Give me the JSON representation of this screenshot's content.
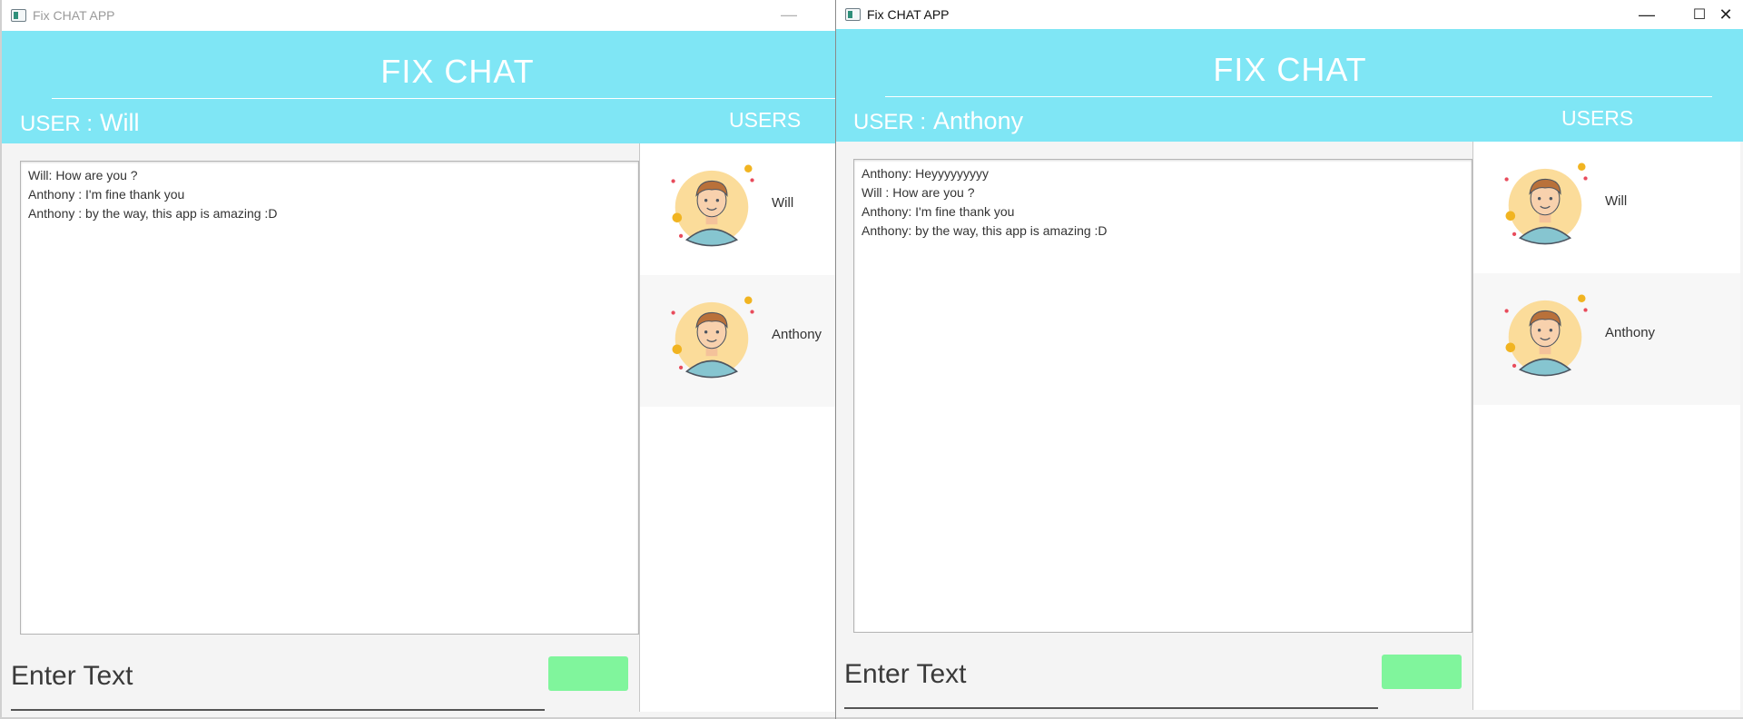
{
  "colors": {
    "header_bg": "#7fe6f5",
    "send_button": "#80f59c",
    "window_bg": "#f4f4f4"
  },
  "windows": [
    {
      "id": "will",
      "title": "Fix CHAT APP",
      "app_title": "FIX CHAT",
      "user_prefix": "USER :",
      "user_name": "Will",
      "users_title": "USERS",
      "messages": [
        "Will: How are you ?",
        "Anthony : I'm fine thank you",
        "Anthony : by the way, this app is amazing :D"
      ],
      "input_placeholder": "Enter Text",
      "users": [
        {
          "name": "Will",
          "avatar_icon": "user-avatar-icon"
        },
        {
          "name": "Anthony",
          "avatar_icon": "user-avatar-icon"
        }
      ]
    },
    {
      "id": "anthony",
      "title": "Fix CHAT APP",
      "app_title": "FIX CHAT",
      "user_prefix": "USER :",
      "user_name": "Anthony",
      "users_title": "USERS",
      "messages": [
        "Anthony: Heyyyyyyyyy",
        "Will : How are you ?",
        "Anthony: I'm fine thank you",
        "Anthony: by the way, this app is amazing :D"
      ],
      "input_placeholder": "Enter Text",
      "users": [
        {
          "name": "Will",
          "avatar_icon": "user-avatar-icon"
        },
        {
          "name": "Anthony",
          "avatar_icon": "user-avatar-icon"
        }
      ]
    }
  ]
}
